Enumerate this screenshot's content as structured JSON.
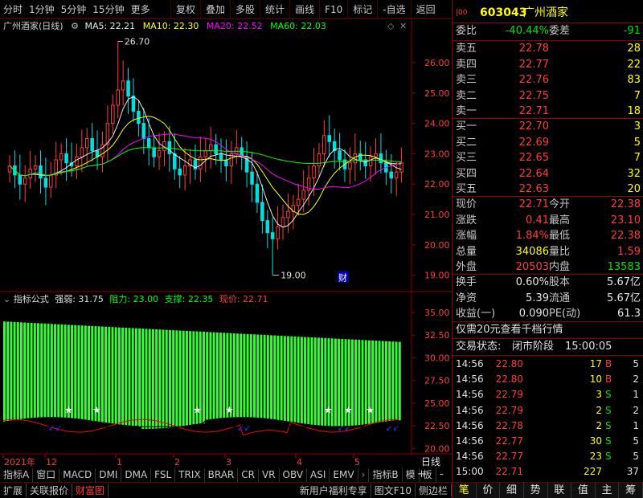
{
  "toolbar": {
    "items": [
      "分时",
      "1分钟",
      "5分钟",
      "15分钟",
      "更多"
    ],
    "right": [
      "复权",
      "叠加",
      "多股",
      "统计",
      "画线",
      "F10",
      "标记",
      "-自选",
      "返回"
    ]
  },
  "main_header": {
    "name": "广州酒家(日线)",
    "ma5": "MA5: 22.21",
    "ma10": "MA10: 22.30",
    "ma20": "MA20: 22.52",
    "ma60": "MA60: 22.03",
    "ma5_color": "#e8e8e8",
    "ma10_color": "#ffff00",
    "ma20_color": "#ff00ff",
    "ma60_color": "#00ff00"
  },
  "sub_header": {
    "name": "指标公式",
    "strength": "强弱: 31.75",
    "resistance": "阻力: 23.00",
    "support": "支撑: 22.35",
    "price": "现价: 22.71"
  },
  "chart_data": [
    {
      "type": "candlestick",
      "title": "广州酒家(日线)",
      "y_ticks": [
        "26.00",
        "25.00",
        "24.00",
        "23.00",
        "22.00",
        "21.00",
        "20.00",
        "19.00"
      ],
      "ylim": [
        18.7,
        26.9
      ],
      "high_label": "26.70",
      "low_label": "19.00",
      "annotation": "财",
      "close_series": [
        22.6,
        22.3,
        22.0,
        22.2,
        22.5,
        22.6,
        22.2,
        21.9,
        22.3,
        22.8,
        23.0,
        22.7,
        22.6,
        22.9,
        23.2,
        23.5,
        23.1,
        22.9,
        23.3,
        24.0,
        24.6,
        25.1,
        25.4,
        24.9,
        24.4,
        24.0,
        23.5,
        23.2,
        22.9,
        23.1,
        23.4,
        23.0,
        22.5,
        22.3,
        22.6,
        22.8,
        22.5,
        22.9,
        23.1,
        23.3,
        23.0,
        22.8,
        22.6,
        23.0,
        23.2,
        22.9,
        22.4,
        22.0,
        21.4,
        20.8,
        20.4,
        20.2,
        20.6,
        20.9,
        21.1,
        21.3,
        21.5,
        21.8,
        22.2,
        22.6,
        23.0,
        23.6,
        23.4,
        23.1,
        22.8,
        22.5,
        22.7,
        23.0,
        22.8,
        22.6,
        22.9,
        23.0,
        22.7,
        22.4,
        22.2,
        22.4,
        22.7
      ],
      "x_labels": [
        "2021年",
        "12",
        "1",
        "2",
        "3",
        "4",
        "5"
      ]
    },
    {
      "type": "bar",
      "title": "指标公式",
      "y_ticks": [
        "35.00",
        "32.50",
        "30.00",
        "27.50",
        "25.00",
        "22.50",
        "20.00"
      ],
      "ylim": [
        19.5,
        36.5
      ],
      "bar_top_start": 34.0,
      "bar_top_end": 31.75,
      "bar_bottom_base": 22.5
    }
  ],
  "bottom_axis_right": "日线",
  "index_tabs": [
    "指标A",
    "窗口",
    "MACD",
    "DMI",
    "DMA",
    "FSL",
    "TRIX",
    "BRAR",
    "CR",
    "VR",
    "OBV",
    "ASI",
    "EMV",
    "指标B",
    "模",
    "板"
  ],
  "bottom_bar": [
    "扩展",
    "关联报价",
    "财富图",
    "新用户福利专享",
    "图文F10",
    "侧边栏"
  ],
  "quote": {
    "code": "603043",
    "name": "广州酒家",
    "weibi_label": "委比",
    "weibi": "-40.44%",
    "weicha_label": "委差",
    "weicha": "-91",
    "sells": [
      {
        "label": "卖五",
        "price": "22.78",
        "vol": "28"
      },
      {
        "label": "卖四",
        "price": "22.77",
        "vol": "22"
      },
      {
        "label": "卖三",
        "price": "22.76",
        "vol": "83"
      },
      {
        "label": "卖二",
        "price": "22.75",
        "vol": "7"
      },
      {
        "label": "卖一",
        "price": "22.71",
        "vol": "18"
      }
    ],
    "buys": [
      {
        "label": "买一",
        "price": "22.70",
        "vol": "3"
      },
      {
        "label": "买二",
        "price": "22.69",
        "vol": "5"
      },
      {
        "label": "买三",
        "price": "22.65",
        "vol": "7"
      },
      {
        "label": "买四",
        "price": "22.64",
        "vol": "32"
      },
      {
        "label": "买五",
        "price": "22.63",
        "vol": "20"
      }
    ],
    "stats": [
      {
        "l1": "现价",
        "v1": "22.71",
        "c1": "red",
        "l2": "今开",
        "v2": "22.38",
        "c2": "red"
      },
      {
        "l1": "涨跌",
        "v1": "0.41",
        "c1": "red",
        "l2": "最高",
        "v2": "23.10",
        "c2": "red"
      },
      {
        "l1": "涨幅",
        "v1": "1.84%",
        "c1": "red",
        "l2": "最低",
        "v2": "22.38",
        "c2": "red"
      },
      {
        "l1": "总量",
        "v1": "34086",
        "c1": "yel",
        "l2": "量比",
        "v2": "1.59",
        "c2": "red"
      },
      {
        "l1": "外盘",
        "v1": "20503",
        "c1": "red",
        "l2": "内盘",
        "v2": "13583",
        "c2": "grn"
      }
    ],
    "stats2": [
      {
        "l1": "换手",
        "v1": "0.60%",
        "l2": "股本",
        "v2": "5.67亿"
      },
      {
        "l1": "净资",
        "v1": "5.39",
        "l2": "流通",
        "v2": "5.67亿"
      },
      {
        "l1": "收益(一)",
        "v1": "0.090",
        "l2": "PE(动)",
        "v2": "61.3"
      }
    ],
    "promo": "仅需20元查看千档行情",
    "status_label": "交易状态:",
    "status": "闭市阶段",
    "status_time": "15:00:05",
    "ticks": [
      {
        "t": "14:56",
        "p": "22.80",
        "v": "17",
        "d": "B",
        "n": "5"
      },
      {
        "t": "14:56",
        "p": "22.80",
        "v": "10",
        "d": "B",
        "n": "2"
      },
      {
        "t": "14:56",
        "p": "22.79",
        "v": "3",
        "d": "S",
        "n": "1"
      },
      {
        "t": "14:56",
        "p": "22.79",
        "v": "2",
        "d": "S",
        "n": "2"
      },
      {
        "t": "14:56",
        "p": "22.78",
        "v": "2",
        "d": "S",
        "n": "1"
      },
      {
        "t": "14:56",
        "p": "22.77",
        "v": "30",
        "d": "S",
        "n": "5"
      },
      {
        "t": "14:56",
        "p": "22.77",
        "v": "23",
        "d": "S",
        "n": "5"
      },
      {
        "t": "15:00",
        "p": "22.71",
        "v": "227",
        "d": "",
        "n": "37"
      }
    ],
    "tabs": [
      "笔",
      "价",
      "细",
      "势",
      "联",
      "值",
      "主",
      "筹"
    ]
  }
}
